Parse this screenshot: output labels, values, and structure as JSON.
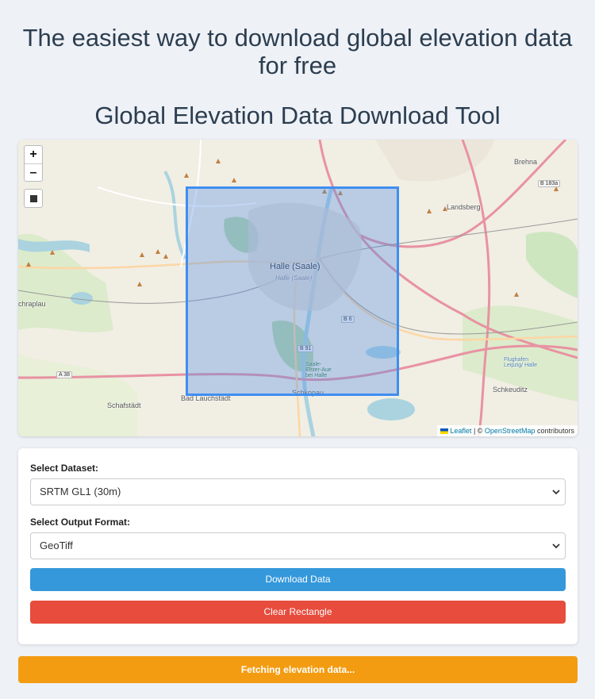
{
  "header": {
    "hero_title": "The easiest way to download global elevation data for free",
    "tool_title": "Global Elevation Data Download Tool"
  },
  "map": {
    "zoom_in": "+",
    "zoom_out": "–",
    "labels": {
      "halle": "Halle (Saale)",
      "halle_sub": "Halle (Saale)",
      "landsberg": "Landsberg",
      "brehna": "Brehna",
      "schafstadt": "Schafstädt",
      "bad_lauchstadt": "Bad Lauchstädt",
      "schkopau": "Schkopau",
      "schkeuditz": "Schkeuditz",
      "schraplau": "chraplau",
      "flughafen": "Flughafen Leipzig/ Halle",
      "aue": "Saale-Elster-Aue bei Halle",
      "road_b6": "B 6",
      "road_b91": "B 91",
      "road_a38": "A 38",
      "road_b183a": "B 183a"
    },
    "attribution": {
      "leaflet": "Leaflet",
      "sep": " | © ",
      "osm": "OpenStreetMap",
      "contributors": " contributors"
    },
    "colors": {
      "selection_border": "#3f8ef0",
      "selection_fill": "rgba(80,140,230,0.35)"
    }
  },
  "form": {
    "dataset_label": "Select Dataset:",
    "dataset_value": "SRTM GL1 (30m)",
    "format_label": "Select Output Format:",
    "format_value": "GeoTiff",
    "download_button": "Download Data",
    "clear_button": "Clear Rectangle"
  },
  "status": {
    "text": "Fetching elevation data...",
    "color": "#f39c12"
  }
}
